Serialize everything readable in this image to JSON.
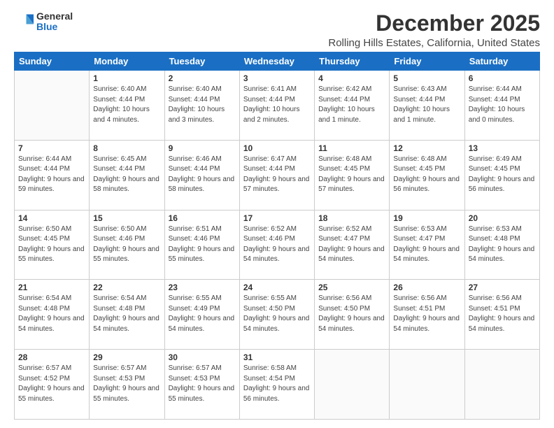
{
  "logo": {
    "general": "General",
    "blue": "Blue"
  },
  "header": {
    "title": "December 2025",
    "subtitle": "Rolling Hills Estates, California, United States"
  },
  "days_of_week": [
    "Sunday",
    "Monday",
    "Tuesday",
    "Wednesday",
    "Thursday",
    "Friday",
    "Saturday"
  ],
  "weeks": [
    [
      {
        "day": "",
        "sunrise": "",
        "sunset": "",
        "daylight": ""
      },
      {
        "day": "1",
        "sunrise": "Sunrise: 6:40 AM",
        "sunset": "Sunset: 4:44 PM",
        "daylight": "Daylight: 10 hours and 4 minutes."
      },
      {
        "day": "2",
        "sunrise": "Sunrise: 6:40 AM",
        "sunset": "Sunset: 4:44 PM",
        "daylight": "Daylight: 10 hours and 3 minutes."
      },
      {
        "day": "3",
        "sunrise": "Sunrise: 6:41 AM",
        "sunset": "Sunset: 4:44 PM",
        "daylight": "Daylight: 10 hours and 2 minutes."
      },
      {
        "day": "4",
        "sunrise": "Sunrise: 6:42 AM",
        "sunset": "Sunset: 4:44 PM",
        "daylight": "Daylight: 10 hours and 1 minute."
      },
      {
        "day": "5",
        "sunrise": "Sunrise: 6:43 AM",
        "sunset": "Sunset: 4:44 PM",
        "daylight": "Daylight: 10 hours and 1 minute."
      },
      {
        "day": "6",
        "sunrise": "Sunrise: 6:44 AM",
        "sunset": "Sunset: 4:44 PM",
        "daylight": "Daylight: 10 hours and 0 minutes."
      }
    ],
    [
      {
        "day": "7",
        "sunrise": "Sunrise: 6:44 AM",
        "sunset": "Sunset: 4:44 PM",
        "daylight": "Daylight: 9 hours and 59 minutes."
      },
      {
        "day": "8",
        "sunrise": "Sunrise: 6:45 AM",
        "sunset": "Sunset: 4:44 PM",
        "daylight": "Daylight: 9 hours and 58 minutes."
      },
      {
        "day": "9",
        "sunrise": "Sunrise: 6:46 AM",
        "sunset": "Sunset: 4:44 PM",
        "daylight": "Daylight: 9 hours and 58 minutes."
      },
      {
        "day": "10",
        "sunrise": "Sunrise: 6:47 AM",
        "sunset": "Sunset: 4:44 PM",
        "daylight": "Daylight: 9 hours and 57 minutes."
      },
      {
        "day": "11",
        "sunrise": "Sunrise: 6:48 AM",
        "sunset": "Sunset: 4:45 PM",
        "daylight": "Daylight: 9 hours and 57 minutes."
      },
      {
        "day": "12",
        "sunrise": "Sunrise: 6:48 AM",
        "sunset": "Sunset: 4:45 PM",
        "daylight": "Daylight: 9 hours and 56 minutes."
      },
      {
        "day": "13",
        "sunrise": "Sunrise: 6:49 AM",
        "sunset": "Sunset: 4:45 PM",
        "daylight": "Daylight: 9 hours and 56 minutes."
      }
    ],
    [
      {
        "day": "14",
        "sunrise": "Sunrise: 6:50 AM",
        "sunset": "Sunset: 4:45 PM",
        "daylight": "Daylight: 9 hours and 55 minutes."
      },
      {
        "day": "15",
        "sunrise": "Sunrise: 6:50 AM",
        "sunset": "Sunset: 4:46 PM",
        "daylight": "Daylight: 9 hours and 55 minutes."
      },
      {
        "day": "16",
        "sunrise": "Sunrise: 6:51 AM",
        "sunset": "Sunset: 4:46 PM",
        "daylight": "Daylight: 9 hours and 55 minutes."
      },
      {
        "day": "17",
        "sunrise": "Sunrise: 6:52 AM",
        "sunset": "Sunset: 4:46 PM",
        "daylight": "Daylight: 9 hours and 54 minutes."
      },
      {
        "day": "18",
        "sunrise": "Sunrise: 6:52 AM",
        "sunset": "Sunset: 4:47 PM",
        "daylight": "Daylight: 9 hours and 54 minutes."
      },
      {
        "day": "19",
        "sunrise": "Sunrise: 6:53 AM",
        "sunset": "Sunset: 4:47 PM",
        "daylight": "Daylight: 9 hours and 54 minutes."
      },
      {
        "day": "20",
        "sunrise": "Sunrise: 6:53 AM",
        "sunset": "Sunset: 4:48 PM",
        "daylight": "Daylight: 9 hours and 54 minutes."
      }
    ],
    [
      {
        "day": "21",
        "sunrise": "Sunrise: 6:54 AM",
        "sunset": "Sunset: 4:48 PM",
        "daylight": "Daylight: 9 hours and 54 minutes."
      },
      {
        "day": "22",
        "sunrise": "Sunrise: 6:54 AM",
        "sunset": "Sunset: 4:48 PM",
        "daylight": "Daylight: 9 hours and 54 minutes."
      },
      {
        "day": "23",
        "sunrise": "Sunrise: 6:55 AM",
        "sunset": "Sunset: 4:49 PM",
        "daylight": "Daylight: 9 hours and 54 minutes."
      },
      {
        "day": "24",
        "sunrise": "Sunrise: 6:55 AM",
        "sunset": "Sunset: 4:50 PM",
        "daylight": "Daylight: 9 hours and 54 minutes."
      },
      {
        "day": "25",
        "sunrise": "Sunrise: 6:56 AM",
        "sunset": "Sunset: 4:50 PM",
        "daylight": "Daylight: 9 hours and 54 minutes."
      },
      {
        "day": "26",
        "sunrise": "Sunrise: 6:56 AM",
        "sunset": "Sunset: 4:51 PM",
        "daylight": "Daylight: 9 hours and 54 minutes."
      },
      {
        "day": "27",
        "sunrise": "Sunrise: 6:56 AM",
        "sunset": "Sunset: 4:51 PM",
        "daylight": "Daylight: 9 hours and 54 minutes."
      }
    ],
    [
      {
        "day": "28",
        "sunrise": "Sunrise: 6:57 AM",
        "sunset": "Sunset: 4:52 PM",
        "daylight": "Daylight: 9 hours and 55 minutes."
      },
      {
        "day": "29",
        "sunrise": "Sunrise: 6:57 AM",
        "sunset": "Sunset: 4:53 PM",
        "daylight": "Daylight: 9 hours and 55 minutes."
      },
      {
        "day": "30",
        "sunrise": "Sunrise: 6:57 AM",
        "sunset": "Sunset: 4:53 PM",
        "daylight": "Daylight: 9 hours and 55 minutes."
      },
      {
        "day": "31",
        "sunrise": "Sunrise: 6:58 AM",
        "sunset": "Sunset: 4:54 PM",
        "daylight": "Daylight: 9 hours and 56 minutes."
      },
      {
        "day": "",
        "sunrise": "",
        "sunset": "",
        "daylight": ""
      },
      {
        "day": "",
        "sunrise": "",
        "sunset": "",
        "daylight": ""
      },
      {
        "day": "",
        "sunrise": "",
        "sunset": "",
        "daylight": ""
      }
    ]
  ]
}
